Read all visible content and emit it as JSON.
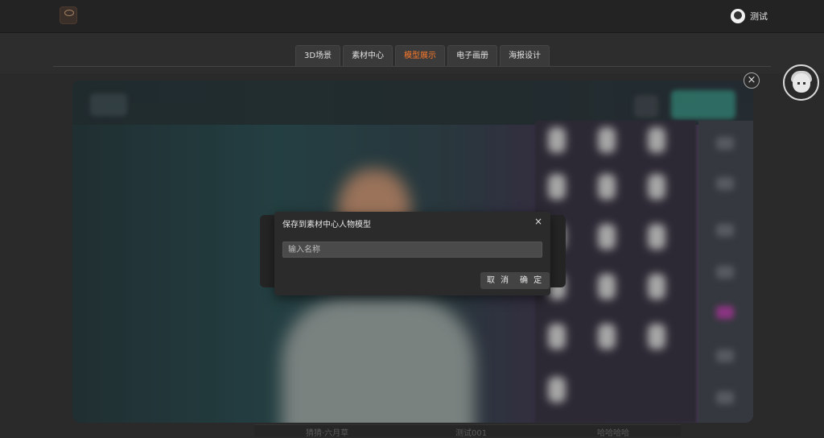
{
  "header": {
    "user_name": "测试"
  },
  "nav": {
    "tabs": [
      "3D场景",
      "素材中心",
      "模型展示",
      "电子画册",
      "海报设计"
    ],
    "active_index": 2
  },
  "dialog": {
    "title": "保存到素材中心人物模型",
    "close_glyph": "×",
    "name_placeholder": "输入名称",
    "name_value": "",
    "cancel_label": "取 消",
    "ok_label": "确 定"
  },
  "overlay": {
    "close_glyph": "×"
  },
  "bottom_labels": [
    "猜猜·六月草",
    "测试001",
    "哈哈哈哈"
  ],
  "colors": {
    "accent": "#ff7a2a",
    "background": "#2a2a2a",
    "dialog": "#2b2b2b"
  },
  "icons": {
    "logo": "brand-logo-icon",
    "avatar": "user-avatar-icon",
    "service": "customer-service-icon"
  }
}
